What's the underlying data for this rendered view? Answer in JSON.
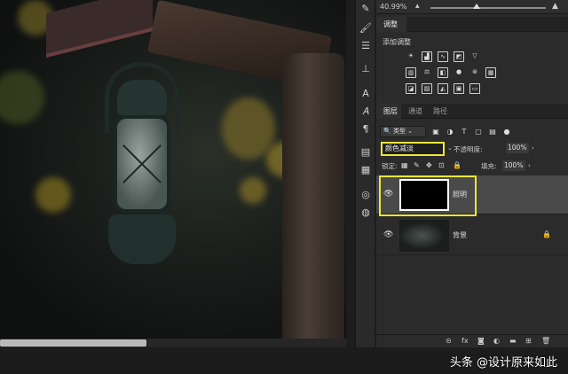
{
  "zoom": {
    "value": "40.99%",
    "slider_level": 0.4
  },
  "adjustments": {
    "tab_label": "调整",
    "add_label": "添加调整"
  },
  "layers_panel": {
    "tabs": [
      {
        "label": "图层",
        "active": true
      },
      {
        "label": "通道",
        "active": false
      },
      {
        "label": "路径",
        "active": false
      }
    ],
    "kind_select": "类型",
    "blend_mode": "颜色减淡",
    "opacity_label": "不透明度:",
    "opacity_value": "100%",
    "lock_label": "锁定:",
    "fill_label": "填充:",
    "fill_value": "100%",
    "layers": [
      {
        "name": "照明",
        "selected": true,
        "thumbnail": "black-fill",
        "locked": false
      },
      {
        "name": "背景",
        "selected": false,
        "thumbnail": "photo",
        "locked": true
      }
    ]
  },
  "toolstrip_icons": [
    "brush-icon",
    "sliders-icon",
    "stamp-icon",
    "text-icon",
    "text-path-icon",
    "paragraph-icon",
    "document-icon",
    "notes-icon",
    "swatch-icon",
    "3d-icon"
  ],
  "highlight_color": "#f0e53a",
  "watermark": "头条 @设计原来如此"
}
